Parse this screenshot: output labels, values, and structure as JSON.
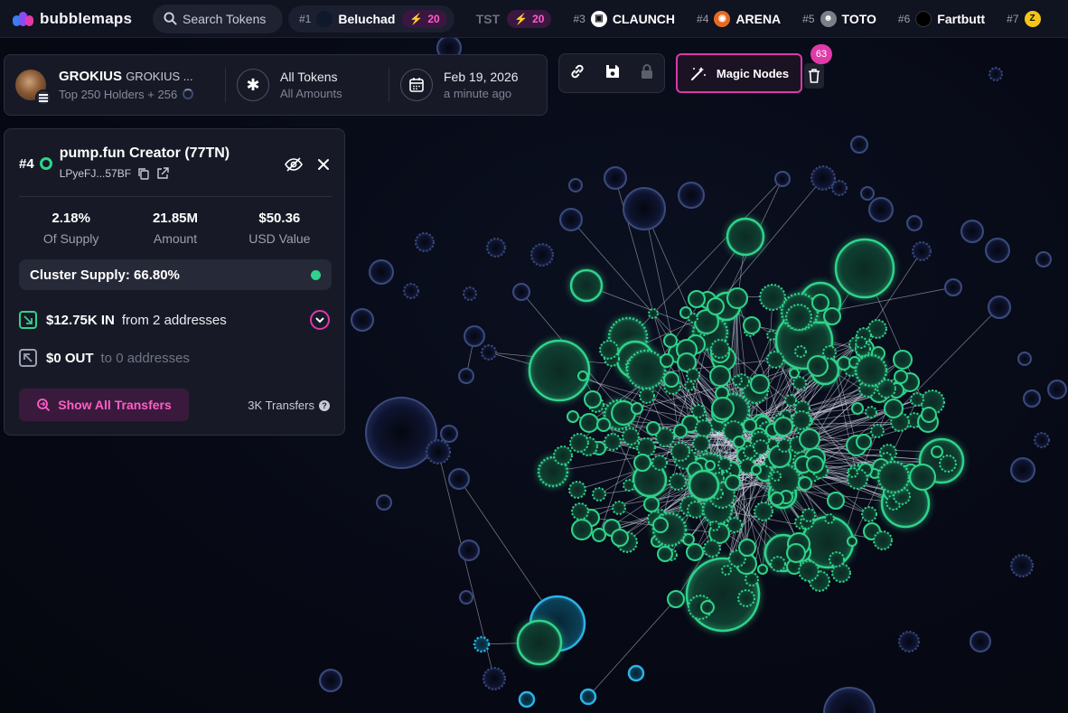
{
  "app": {
    "logo_text": "bubblemaps"
  },
  "search": {
    "label": "Search Tokens"
  },
  "tickers": [
    {
      "rank": "#1",
      "name": "Beluchad",
      "boost": "20",
      "icon_bg": "#1d3a5c",
      "icon": "moon-icon"
    },
    {
      "rank": "",
      "name": "TST",
      "boost": "20",
      "icon_bg": "",
      "icon": ""
    },
    {
      "rank": "#3",
      "name": "CLAUNCH",
      "icon_bg": "#ffffff",
      "icon": "square-logo-icon"
    },
    {
      "rank": "#4",
      "name": "ARENA",
      "icon_bg": "#e66a22",
      "icon": "arena-icon"
    },
    {
      "rank": "#5",
      "name": "TOTO",
      "icon_bg": "#7a7f8a",
      "icon": "toto-icon"
    },
    {
      "rank": "#6",
      "name": "Fartbutt",
      "icon_bg": "#111111",
      "icon": "fartbutt-icon"
    },
    {
      "rank": "#7",
      "name": "Z",
      "icon_bg": "#f5c518",
      "icon": "z-icon"
    }
  ],
  "token": {
    "name": "GROKIUS",
    "subname": "GROKIUS ...",
    "holders": "Top 250 Holders + 256",
    "filter_title": "All Tokens",
    "filter_sub": "All Amounts",
    "date": "Feb 19, 2026",
    "date_sub": "a minute ago"
  },
  "toolbar": {
    "magic_label": "Magic Nodes",
    "badge": "63"
  },
  "holder": {
    "rank": "#4",
    "name": "pump.fun Creator (77TN)",
    "address": "LPyeFJ...57BF",
    "stats": [
      {
        "value": "2.18%",
        "label": "Of Supply"
      },
      {
        "value": "21.85M",
        "label": "Amount"
      },
      {
        "value": "$50.36",
        "label": "USD Value"
      }
    ],
    "cluster_supply": "Cluster Supply: 66.80%",
    "in_value": "$12.75K IN",
    "in_text": "from 2 addresses",
    "out_value": "$0 OUT",
    "out_text": "to 0 addresses",
    "show_transfers": "Show All Transfers",
    "transfers_count": "3K Transfers"
  },
  "colors": {
    "accent": "#e13aa8",
    "cluster_green": "#2fd38a",
    "node_blue": "#2a3556",
    "highlight_cyan": "#2ab3e6"
  }
}
